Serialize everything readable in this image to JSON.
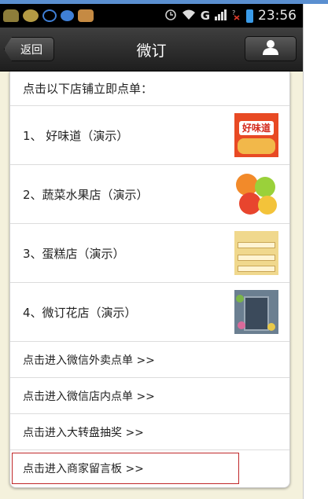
{
  "status_bar": {
    "time": "23:56",
    "signal_label": "G",
    "notification_icons": [
      "app-icon",
      "app-icon",
      "chat-bubble-icon",
      "message-icon",
      "app-icon"
    ],
    "system_icons": [
      "alarm-icon",
      "wifi-icon",
      "signal-icon",
      "battery-icon"
    ]
  },
  "nav": {
    "back_label": "返回",
    "title": "微订",
    "profile_icon": "user-icon"
  },
  "list": {
    "header": "点击以下店铺立即点单：",
    "shops": [
      {
        "label": "1、 好味道（演示）",
        "thumb_text": "好味道"
      },
      {
        "label": "2、蔬菜水果店（演示）"
      },
      {
        "label": "3、蛋糕店（演示）"
      },
      {
        "label": "4、微订花店（演示）"
      }
    ],
    "links": [
      {
        "label": "点击进入微信外卖点单 >>"
      },
      {
        "label": "点击进入微信店内点单 >>"
      },
      {
        "label": "点击进入大转盘抽奖 >>"
      },
      {
        "label": "点击进入商家留言板 >>"
      }
    ]
  },
  "colors": {
    "nav_bar": "#2a2a2a",
    "background": "#f4f1dc",
    "highlight_border": "#c0282a"
  }
}
